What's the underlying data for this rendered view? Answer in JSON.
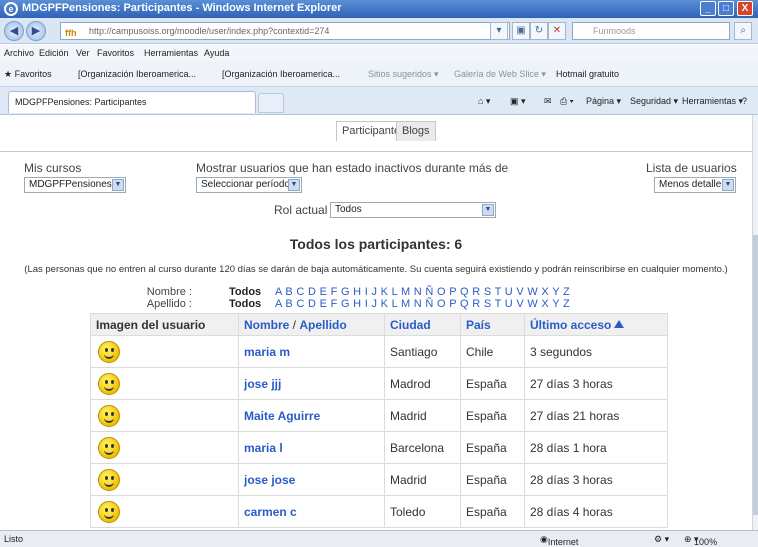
{
  "window": {
    "title": "MDGPFPensiones: Participantes - Windows Internet Explorer",
    "minimize": "_",
    "maximize": "□",
    "close": "X"
  },
  "addressbar": {
    "url": "http://campusoiss.org/moodle/user/index.php?contextid=274",
    "favicon": "ffh",
    "search_placeholder": "Funmoods"
  },
  "menu": [
    "Archivo",
    "Edición",
    "Ver",
    "Favoritos",
    "Herramientas",
    "Ayuda"
  ],
  "favorites": {
    "label": "Favoritos",
    "items": [
      "[Organización Iberoamerica...",
      "[Organización Iberoamerica...",
      "Sitios sugeridos ▾",
      "Galería de Web Slice ▾",
      "Hotmail gratuito"
    ]
  },
  "tab": {
    "title": "MDGPFPensiones: Participantes"
  },
  "commands": [
    "Página ▾",
    "Seguridad ▾",
    "Herramientas ▾"
  ],
  "page": {
    "tabs": [
      "Participantes",
      "Blogs"
    ],
    "mis_cursos_label": "Mis cursos",
    "mis_cursos_value": "MDGPFPensiones",
    "inactive_label": "Mostrar usuarios que han estado inactivos durante más de",
    "inactive_value": "Seleccionar período",
    "lista_label": "Lista de usuarios",
    "lista_value": "Menos detalle",
    "rol_label": "Rol actual",
    "rol_value": "Todos",
    "heading": "Todos los participantes: 6",
    "notice": "(Las personas que no entren al curso durante 120 días se darán de baja automáticamente. Su cuenta seguirá existiendo y podrán reinscribirse en cualquier momento.)",
    "nombre_label": "Nombre :",
    "apellido_label": "Apellido :",
    "todos": "Todos",
    "letters": "A B C D E F G H I J K L M N Ñ O P Q R S T U V W X Y Z"
  },
  "table": {
    "headers": {
      "image": "Imagen del usuario",
      "nombre": "Nombre",
      "sep": " / ",
      "apellido": "Apellido",
      "ciudad": "Ciudad",
      "pais": "País",
      "acceso": "Último acceso"
    },
    "rows": [
      {
        "name": "maria m",
        "city": "Santiago",
        "country": "Chile",
        "access": "3 segundos"
      },
      {
        "name": "jose jjj",
        "city": "Madrod",
        "country": "España",
        "access": "27 días 3 horas"
      },
      {
        "name": "Maite Aguirre",
        "city": "Madrid",
        "country": "España",
        "access": "27 días 21 horas"
      },
      {
        "name": "maria l",
        "city": "Barcelona",
        "country": "España",
        "access": "28 días 1 hora"
      },
      {
        "name": "jose jose",
        "city": "Madrid",
        "country": "España",
        "access": "28 días 3 horas"
      },
      {
        "name": "carmen c",
        "city": "Toledo",
        "country": "España",
        "access": "28 días 4 horas"
      }
    ]
  },
  "status": {
    "left": "Listo",
    "zone": "Internet",
    "zoom": "100%"
  }
}
